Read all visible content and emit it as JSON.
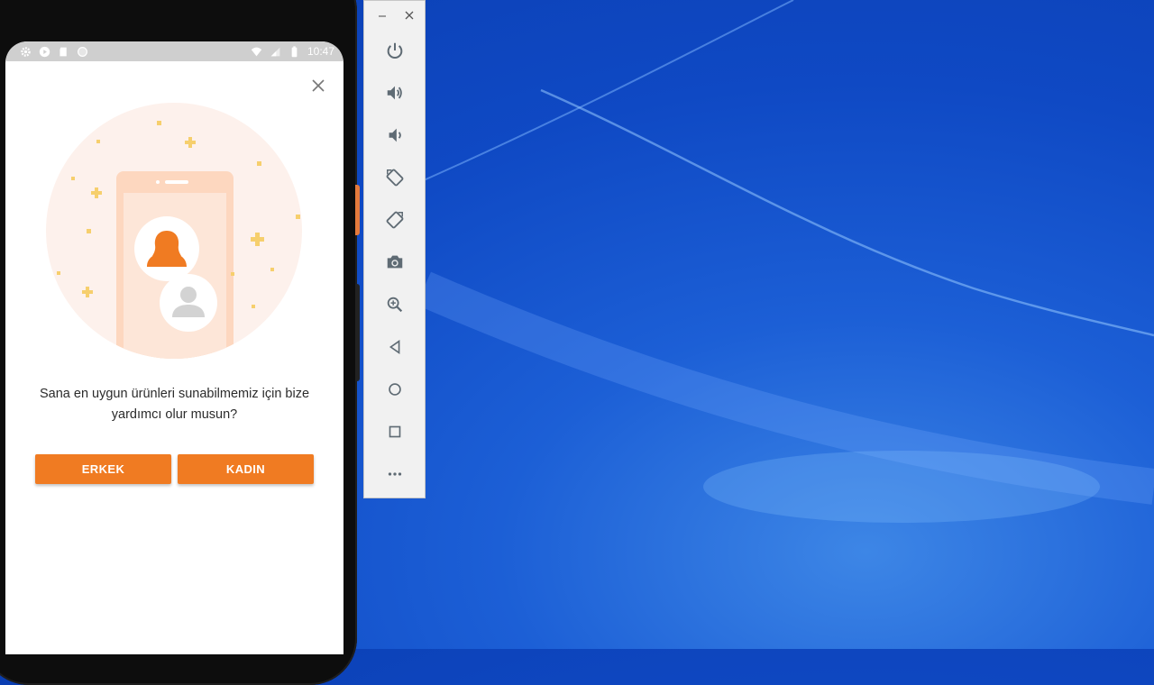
{
  "status_bar": {
    "time": "10:47",
    "left_icons": [
      "settings-icon",
      "play-icon",
      "sd-card-icon",
      "circle-icon"
    ],
    "right_icons": [
      "wifi-icon",
      "signal-icon",
      "battery-icon"
    ]
  },
  "dialog": {
    "question": "Sana en uygun ürünleri sunabilmemiz için bize yardımcı olur musun?",
    "buttons": {
      "erkek": "ERKEK",
      "kadin": "KADIN"
    },
    "accent_color": "#f07b22"
  },
  "emulator_toolbar": {
    "window_controls": [
      "minimize-icon",
      "close-icon"
    ],
    "buttons": [
      "power-icon",
      "volume-up-icon",
      "volume-down-icon",
      "rotate-left-icon",
      "rotate-right-icon",
      "camera-icon",
      "zoom-icon",
      "back-icon",
      "home-icon",
      "overview-icon",
      "more-icon"
    ]
  }
}
